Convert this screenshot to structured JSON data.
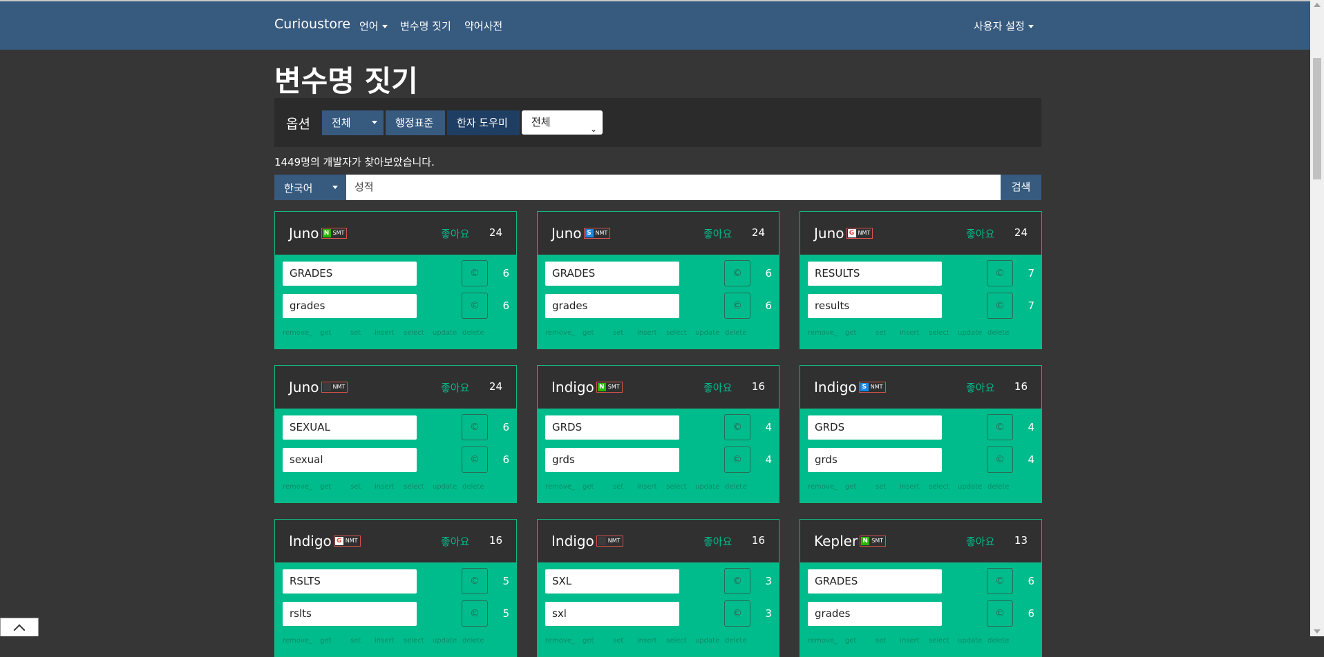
{
  "navbar": {
    "brand": "Curioustore",
    "items": [
      {
        "label": "언어",
        "dropdown": true
      },
      {
        "label": "변수명 짓기",
        "dropdown": false
      },
      {
        "label": "약어사전",
        "dropdown": false
      }
    ],
    "user_settings": "사용자 설정"
  },
  "page_title": "변수명 짓기",
  "options": {
    "label": "옵션",
    "scope_button": "전체",
    "standard_button": "행정표준",
    "hanja_button": "한자 도우미",
    "select_value": "전체"
  },
  "visitors_text": "1449명의 개발자가 찾아보았습니다.",
  "search": {
    "language": "한국어",
    "query": "성적",
    "button": "검색"
  },
  "likes_label": "좋아요",
  "copy_symbol": "©",
  "ops": [
    "remove_",
    "get",
    "set",
    "insert",
    "select",
    "update",
    "delete"
  ],
  "cards": [
    {
      "name": "Juno",
      "engine_icon": "naver-icon",
      "engine_mark": "N",
      "engine": "SMT",
      "likes": "24",
      "words": [
        {
          "text": "GRADES",
          "count": "6"
        },
        {
          "text": "grades",
          "count": "6"
        }
      ]
    },
    {
      "name": "Juno",
      "engine_icon": "papago-icon",
      "engine_mark": "S",
      "engine": "NMT",
      "likes": "24",
      "words": [
        {
          "text": "GRADES",
          "count": "6"
        },
        {
          "text": "grades",
          "count": "6"
        }
      ]
    },
    {
      "name": "Juno",
      "engine_icon": "google-icon",
      "engine_mark": "G",
      "engine": "NMT",
      "likes": "24",
      "words": [
        {
          "text": "RESULTS",
          "count": "7"
        },
        {
          "text": "results",
          "count": "7"
        }
      ]
    },
    {
      "name": "Juno",
      "engine_icon": "kakao-icon",
      "engine_mark": "",
      "engine": "NMT",
      "likes": "24",
      "words": [
        {
          "text": "SEXUAL",
          "count": "6"
        },
        {
          "text": "sexual",
          "count": "6"
        }
      ]
    },
    {
      "name": "Indigo",
      "engine_icon": "naver-icon",
      "engine_mark": "N",
      "engine": "SMT",
      "likes": "16",
      "words": [
        {
          "text": "GRDS",
          "count": "4"
        },
        {
          "text": "grds",
          "count": "4"
        }
      ]
    },
    {
      "name": "Indigo",
      "engine_icon": "papago-icon",
      "engine_mark": "S",
      "engine": "NMT",
      "likes": "16",
      "words": [
        {
          "text": "GRDS",
          "count": "4"
        },
        {
          "text": "grds",
          "count": "4"
        }
      ]
    },
    {
      "name": "Indigo",
      "engine_icon": "google-icon",
      "engine_mark": "G",
      "engine": "NMT",
      "likes": "16",
      "words": [
        {
          "text": "RSLTS",
          "count": "5"
        },
        {
          "text": "rslts",
          "count": "5"
        }
      ]
    },
    {
      "name": "Indigo",
      "engine_icon": "kakao-icon",
      "engine_mark": "",
      "engine": "NMT",
      "likes": "16",
      "words": [
        {
          "text": "SXL",
          "count": "3"
        },
        {
          "text": "sxl",
          "count": "3"
        }
      ]
    },
    {
      "name": "Kepler",
      "engine_icon": "naver-icon",
      "engine_mark": "N",
      "engine": "SMT",
      "likes": "13",
      "words": [
        {
          "text": "GRADES",
          "count": "6"
        },
        {
          "text": "grades",
          "count": "6"
        }
      ]
    }
  ]
}
